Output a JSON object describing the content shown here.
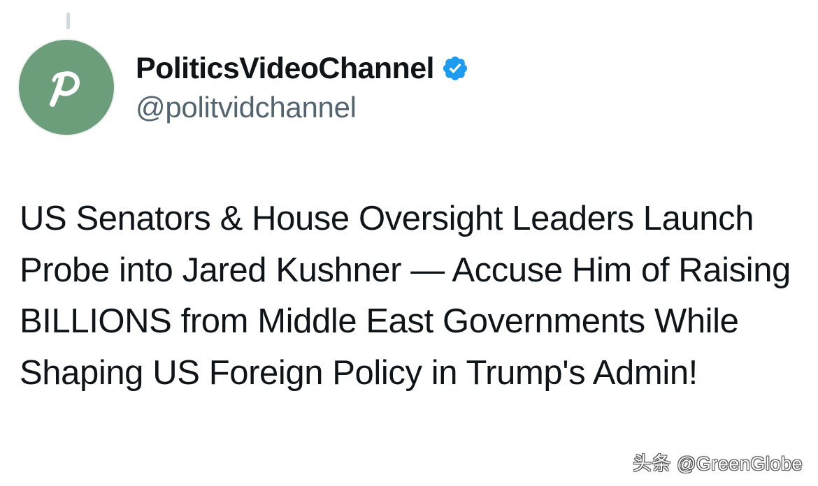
{
  "tweet": {
    "author": {
      "display_name": "PoliticsVideoChannel",
      "handle": "@politvidchannel",
      "avatar_icon": "script-p-logo-icon",
      "avatar_color": "#6c9e7c",
      "verified": true,
      "verified_icon": "verified-badge-icon",
      "verified_color": "#1d9bf0"
    },
    "text": "US Senators & House Oversight Leaders Launch Probe into Jared Kushner — Accuse Him of Raising BILLIONS from Middle East Governments While Shaping US Foreign Policy in Trump's Admin!"
  },
  "watermark": {
    "text": "头条 @GreenGlobe"
  },
  "colors": {
    "text_primary": "#0f1419",
    "text_secondary": "#536471",
    "background": "#ffffff"
  }
}
